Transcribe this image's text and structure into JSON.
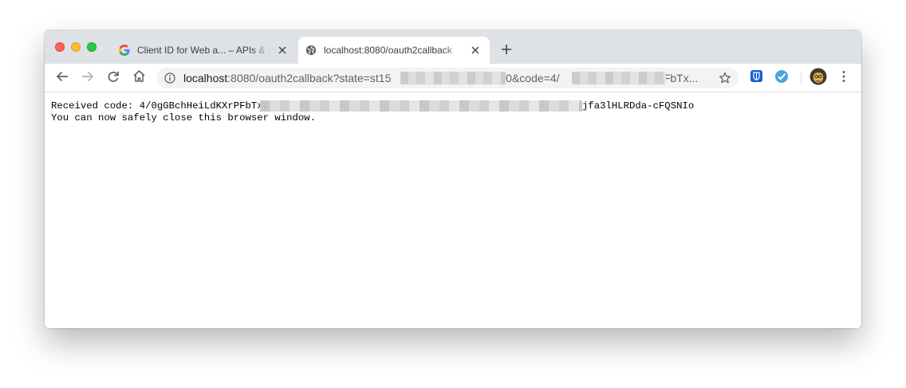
{
  "tabs": [
    {
      "title": "Client ID for Web a... – APIs & S",
      "favicon": "google-g-icon",
      "active": false
    },
    {
      "title": "localhost:8080/oauth2callback",
      "favicon": "globe-icon",
      "active": true
    }
  ],
  "new_tab_icon": "plus-icon",
  "toolbar": {
    "back_icon": "arrow-left-icon",
    "forward_icon": "arrow-right-icon",
    "reload_icon": "reload-icon",
    "home_icon": "home-icon"
  },
  "omnibox": {
    "host": "localhost",
    "url_part1": ":8080/oauth2callback?state=st15",
    "url_part2": "00&code=4/",
    "url_part3": "PFbTx...",
    "info_icon": "info-icon",
    "star_icon": "star-icon"
  },
  "extensions": [
    "bitwarden-icon",
    "checkmark-extension-icon"
  ],
  "profile": {
    "avatar": "avatar"
  },
  "menu_icon": "kebab-menu-icon",
  "page": {
    "line1_prefix": "Received code: 4/0gGBchHeiLdKXrPFbTxL",
    "line1_suffix": "jfa3lHLRDda-cFQSNIo",
    "line2": "You can now safely close this browser window."
  },
  "colors": {
    "tabstrip_bg": "#dee1e6",
    "close_red": "#fe5f57",
    "minimize_yellow": "#febc2e",
    "maximize_green": "#28c840",
    "bitwarden_blue": "#175ddc",
    "extension_blue": "#4aa3df"
  }
}
